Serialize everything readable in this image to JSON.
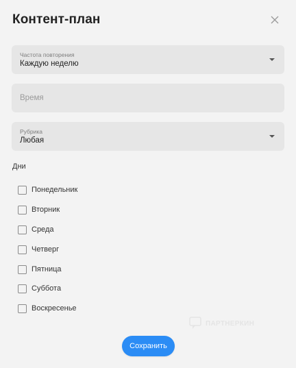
{
  "dialog": {
    "title": "Контент-план"
  },
  "frequency": {
    "label": "Частота повторения",
    "value": "Каждую неделю"
  },
  "time": {
    "placeholder": "Время"
  },
  "category": {
    "label": "Рубрика",
    "value": "Любая"
  },
  "days": {
    "label": "Дни",
    "items": [
      {
        "label": "Понедельник",
        "checked": false
      },
      {
        "label": "Вторник",
        "checked": false
      },
      {
        "label": "Среда",
        "checked": false
      },
      {
        "label": "Четверг",
        "checked": false
      },
      {
        "label": "Пятница",
        "checked": false
      },
      {
        "label": "Суббота",
        "checked": false
      },
      {
        "label": "Воскресенье",
        "checked": false
      }
    ]
  },
  "watermark": {
    "text": "ПАРТНЕРКИН"
  },
  "actions": {
    "save_label": "Сохранить"
  },
  "colors": {
    "background": "#f3f3f3",
    "field_bg": "#e6e6e6",
    "accent": "#2b8cf5"
  }
}
